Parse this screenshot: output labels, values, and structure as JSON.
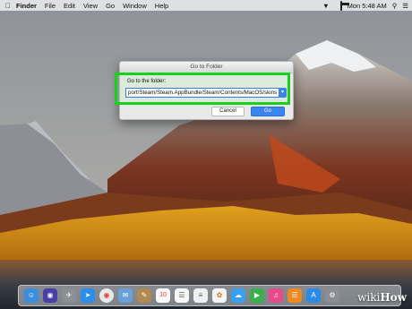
{
  "menubar": {
    "apple_icon": "apple-icon",
    "items": [
      "Finder",
      "File",
      "Edit",
      "View",
      "Go",
      "Window",
      "Help"
    ],
    "clock": "Mon 5:48 AM"
  },
  "dialog": {
    "title": "Go to Folder",
    "prompt": "Go to the folder:",
    "path_value": "port/Steam/Steam.AppBundle/Steam/Contents/MacOS/skins",
    "cancel_label": "Cancel",
    "go_label": "Go",
    "highlight_color": "#19d11a"
  },
  "dock": {
    "items": [
      "finder-icon",
      "siri-icon",
      "launchpad-icon",
      "safari-icon",
      "chrome-icon",
      "mail-icon",
      "notes-icon",
      "calendar-icon",
      "stickies-icon",
      "reminders-icon",
      "photos-icon",
      "messages-icon",
      "facetime-icon",
      "itunes-icon",
      "ibooks-icon",
      "app-store-icon",
      "system-preferences-icon"
    ],
    "calendar_day": "10"
  },
  "watermark": {
    "wiki": "wiki",
    "how": "How"
  }
}
